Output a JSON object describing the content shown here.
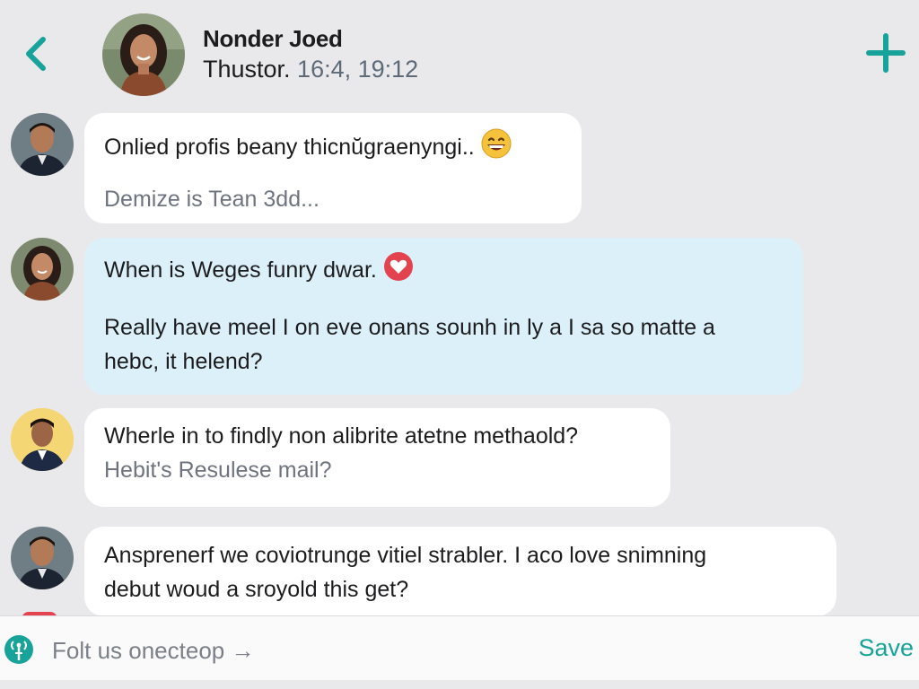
{
  "header": {
    "contact_name": "Nonder Joed",
    "status_prefix": "Thustor.",
    "status_time": " 16:4, 19:12"
  },
  "messages": [
    {
      "lines": [
        "Onlied profis beany thicnŭgraenyngi.."
      ],
      "sub": "Demize is Tean 3dd...",
      "emoji": "grinning-face-emoji"
    },
    {
      "lines": [
        "When is Weges funry dwar."
      ],
      "body": [
        "Really have meel I on eve onans sounh in ly a I sa so matte a",
        "hebc, it helend?"
      ],
      "emoji": "heart-emoji"
    },
    {
      "lines": [
        "Wherle in to findly non alibrite atetne methaold?"
      ],
      "sub": "Hebit's Resulese mail?"
    },
    {
      "lines": [
        "Ansprenerf we coviotrunge vitiel strabler. I aco love snimning",
        "debut woud a sroyold this get?"
      ]
    }
  ],
  "composer": {
    "placeholder": "Folt us onecteop →",
    "save_label": "Save"
  },
  "colors": {
    "accent": "#18a39a",
    "background": "#e9e9ec",
    "bubble": "#ffffff",
    "bubble_tinted": "#dcf0f9"
  },
  "icons": {
    "back": "chevron-left-icon",
    "add": "plus-icon",
    "composer": "antenna-icon"
  }
}
